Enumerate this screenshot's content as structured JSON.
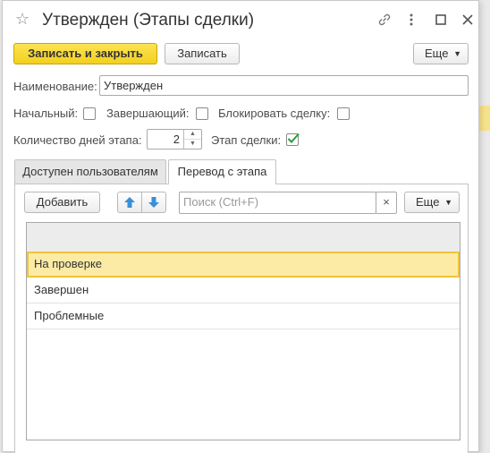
{
  "window": {
    "title": "Утвержден (Этапы сделки)"
  },
  "toolbar": {
    "save_close_label": "Записать и закрыть",
    "save_label": "Записать",
    "more_label": "Еще"
  },
  "form": {
    "name_label": "Наименование:",
    "name_value": "Утвержден",
    "initial_label": "Начальный:",
    "initial_checked": false,
    "final_label": "Завершающий:",
    "final_checked": false,
    "block_label": "Блокировать сделку:",
    "block_checked": false,
    "days_label": "Количество дней этапа:",
    "days_value": "2",
    "deal_stage_label": "Этап сделки:",
    "deal_stage_checked": true
  },
  "tabs": [
    {
      "label": "Доступен пользователям",
      "active": false
    },
    {
      "label": "Перевод с этапа",
      "active": true
    }
  ],
  "panel": {
    "add_label": "Добавить",
    "search_placeholder": "Поиск (Ctrl+F)",
    "clear_label": "×",
    "more_label": "Еще"
  },
  "list": {
    "rows": [
      {
        "label": "На проверке",
        "selected": true
      },
      {
        "label": "Завершен",
        "selected": false
      },
      {
        "label": "Проблемные",
        "selected": false
      }
    ]
  },
  "colors": {
    "primary_button": "#f3d01f",
    "selection_fill": "#fbeba4",
    "selection_border": "#f0c43a",
    "check_mark": "#2a9d3a",
    "arrow_blue": "#3a8fd8"
  }
}
